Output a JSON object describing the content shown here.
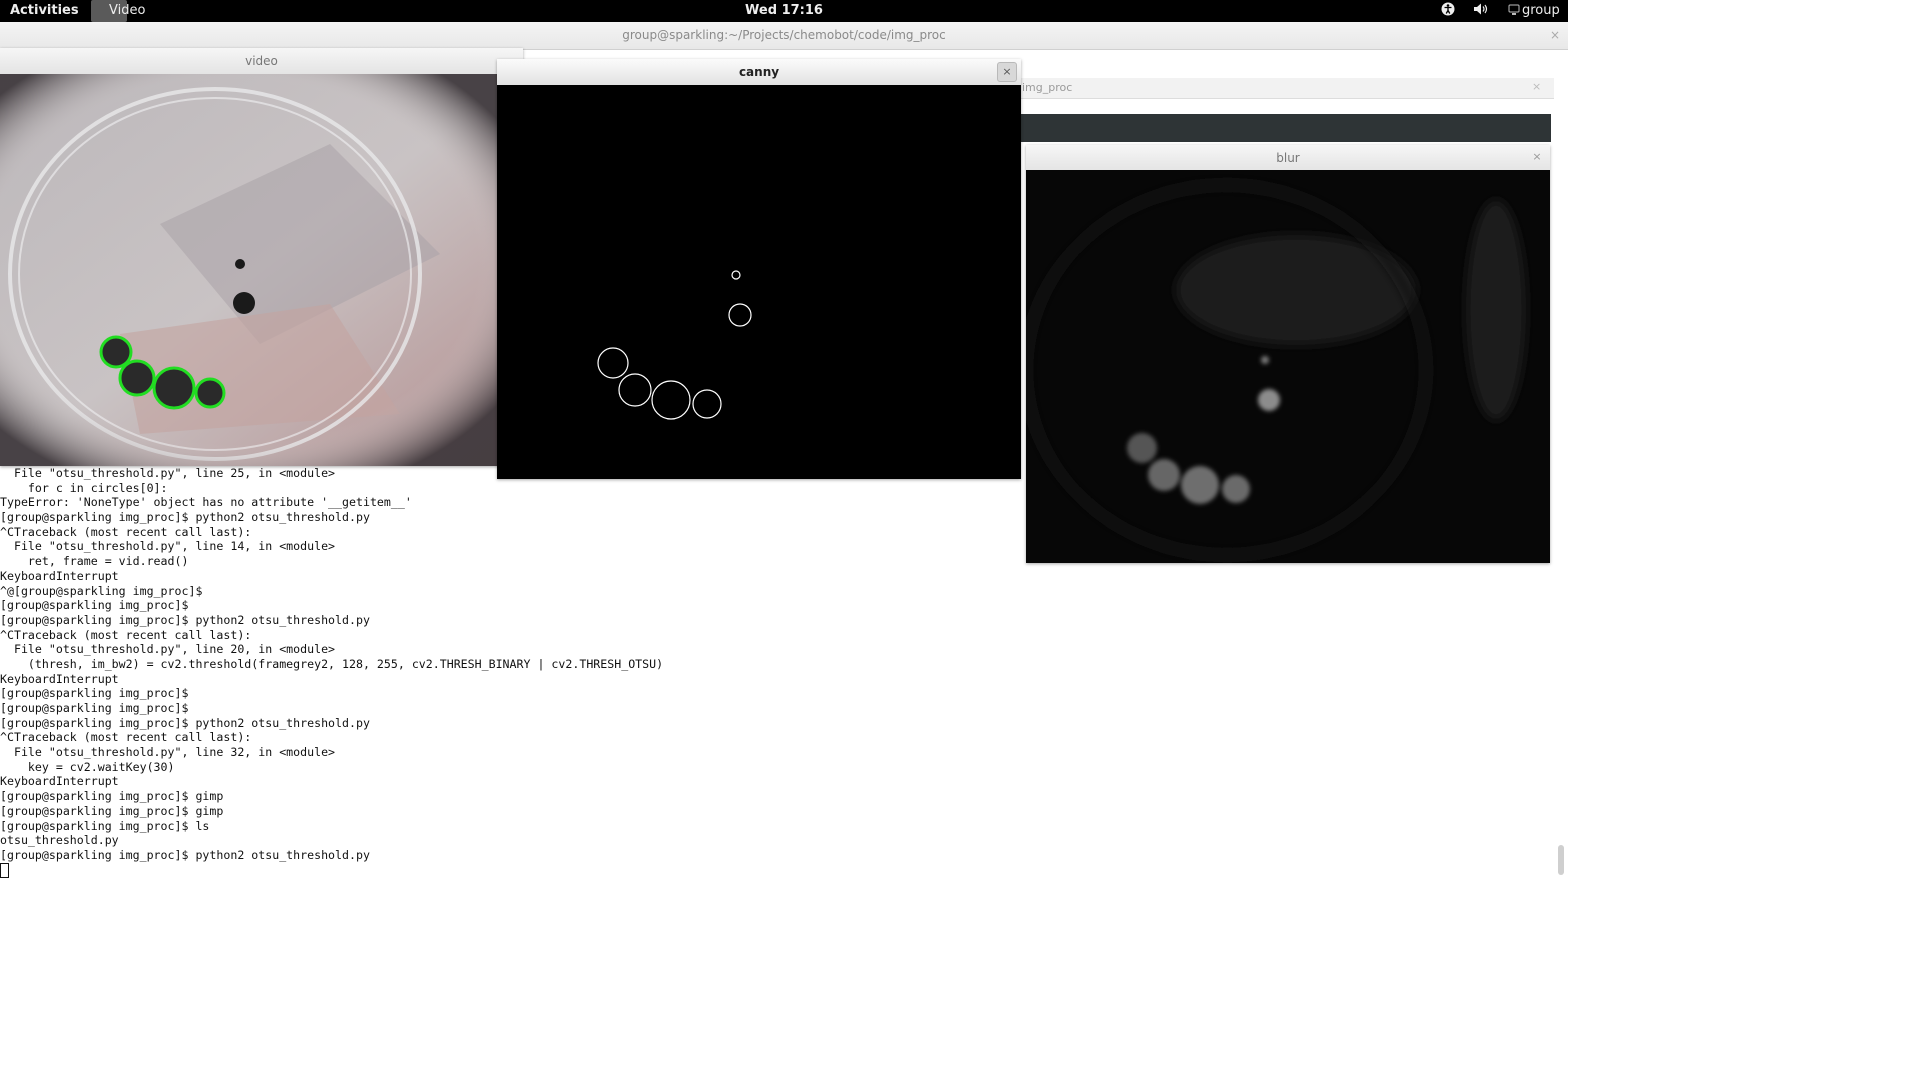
{
  "topbar": {
    "activities": "Activities",
    "app_name": "Video",
    "clock": "Wed 17:16",
    "accessibility_icon": "accessibility-icon",
    "volume_icon": "volume-icon",
    "user_icon": "user-icon",
    "user": "group"
  },
  "terminal": {
    "title": "group@sparkling:~/Projects/chemobot/code/img_proc",
    "close": "×",
    "tab_label": "img_proc",
    "tab_close": "×",
    "lines": [
      "  File \"otsu_threshold.py\", line 25, in <module>",
      "    for c in circles[0]:",
      "TypeError: 'NoneType' object has no attribute '__getitem__'",
      "[group@sparkling img_proc]$ python2 otsu_threshold.py",
      "^CTraceback (most recent call last):",
      "  File \"otsu_threshold.py\", line 14, in <module>",
      "    ret, frame = vid.read()",
      "KeyboardInterrupt",
      "^@[group@sparkling img_proc]$",
      "[group@sparkling img_proc]$",
      "[group@sparkling img_proc]$ python2 otsu_threshold.py",
      "^CTraceback (most recent call last):",
      "  File \"otsu_threshold.py\", line 20, in <module>",
      "    (thresh, im_bw2) = cv2.threshold(framegrey2, 128, 255, cv2.THRESH_BINARY | cv2.THRESH_OTSU)",
      "KeyboardInterrupt",
      "[group@sparkling img_proc]$",
      "[group@sparkling img_proc]$",
      "[group@sparkling img_proc]$ python2 otsu_threshold.py",
      "^CTraceback (most recent call last):",
      "  File \"otsu_threshold.py\", line 32, in <module>",
      "    key = cv2.waitKey(30)",
      "KeyboardInterrupt",
      "[group@sparkling img_proc]$ gimp",
      "[group@sparkling img_proc]$ gimp",
      "[group@sparkling img_proc]$ ls",
      "otsu_threshold.py",
      "[group@sparkling img_proc]$ python2 otsu_threshold.py"
    ]
  },
  "windows": {
    "video": {
      "title": "video"
    },
    "canny": {
      "title": "canny",
      "close": "×"
    },
    "blur": {
      "title": "blur",
      "close": "×"
    }
  },
  "colors": {
    "detection_circle": "#22dd22",
    "canny_background": "#000000",
    "edge": "#ffffff"
  }
}
